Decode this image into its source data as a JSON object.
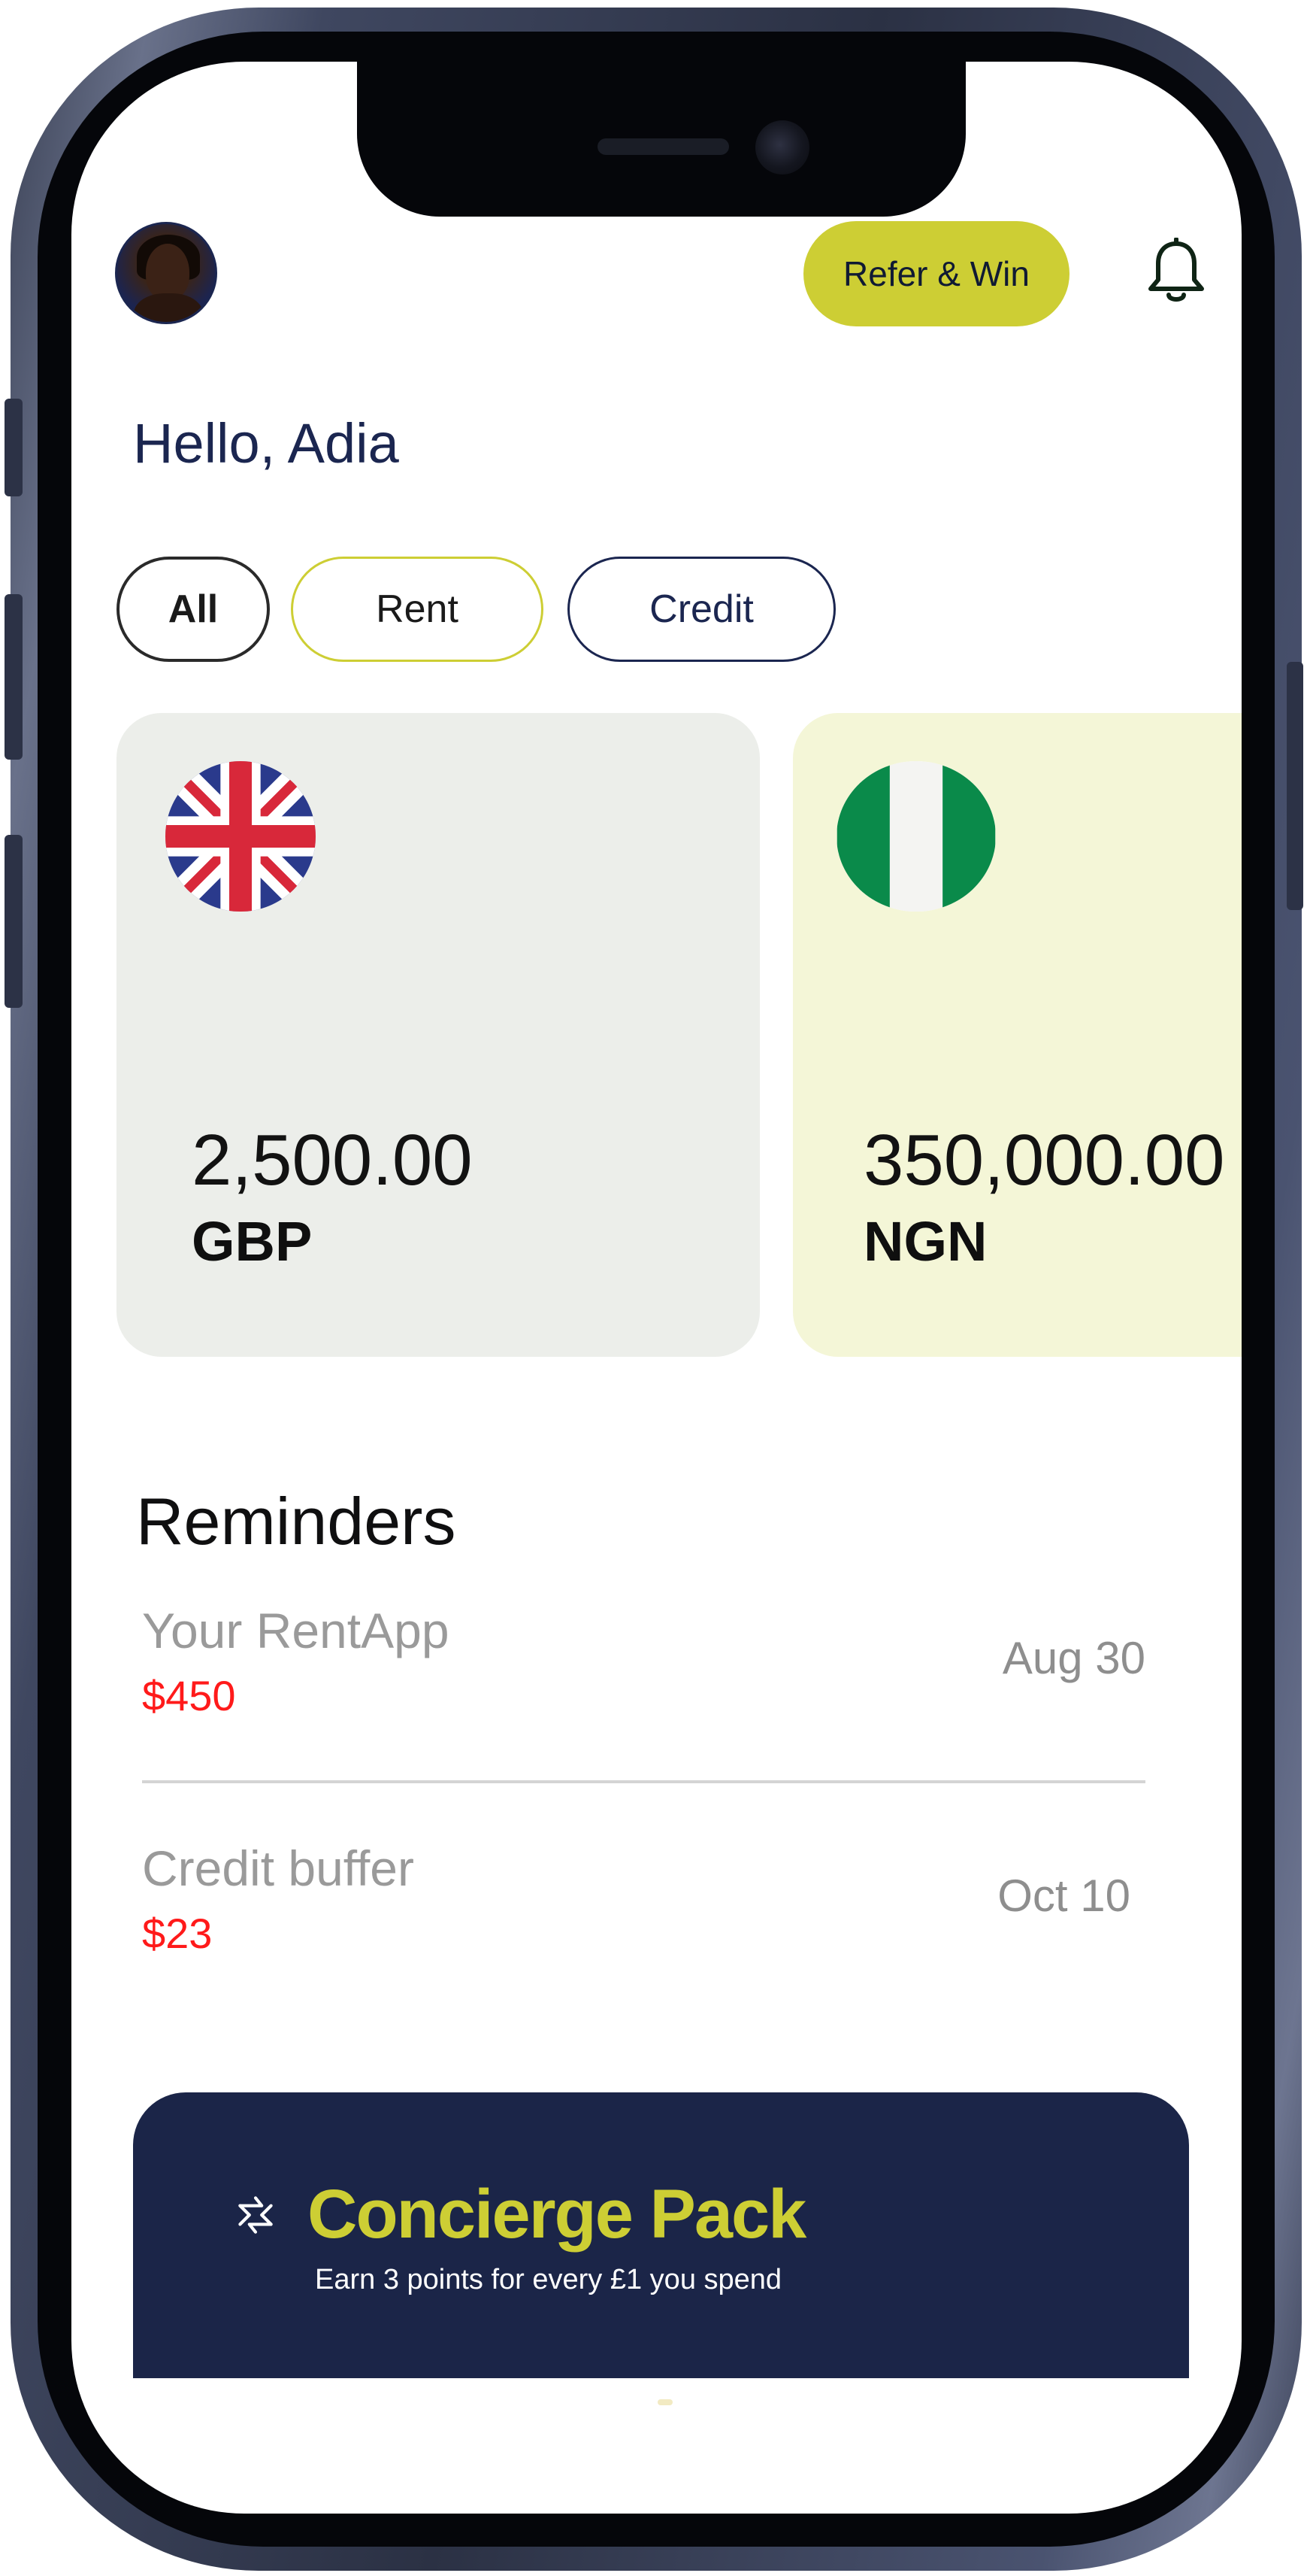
{
  "header": {
    "refer_label": "Refer & Win",
    "greeting": "Hello, Adia"
  },
  "filters": [
    {
      "label": "All",
      "selected": true
    },
    {
      "label": "Rent",
      "selected": false
    },
    {
      "label": "Credit",
      "selected": false
    }
  ],
  "cards": [
    {
      "amount": "2,500.00",
      "currency": "GBP",
      "flag_icon": "uk-flag-icon",
      "color": "#eceeea"
    },
    {
      "amount": "350,000.00",
      "currency": "NGN",
      "flag_icon": "nigeria-flag-icon",
      "color": "#f4f6d7"
    }
  ],
  "reminders": {
    "title": "Reminders",
    "items": [
      {
        "name": "Your RentApp",
        "amount": "$450",
        "date": "Aug 30"
      },
      {
        "name": "Credit buffer",
        "amount": "$23",
        "date": "Oct 10"
      }
    ]
  },
  "concierge": {
    "title": "Concierge Pack",
    "subtitle": "Earn 3 points for every £1 you spend"
  },
  "colors": {
    "accent": "#cdce34",
    "navy": "#1b2548",
    "alert": "#ff1a1a"
  }
}
